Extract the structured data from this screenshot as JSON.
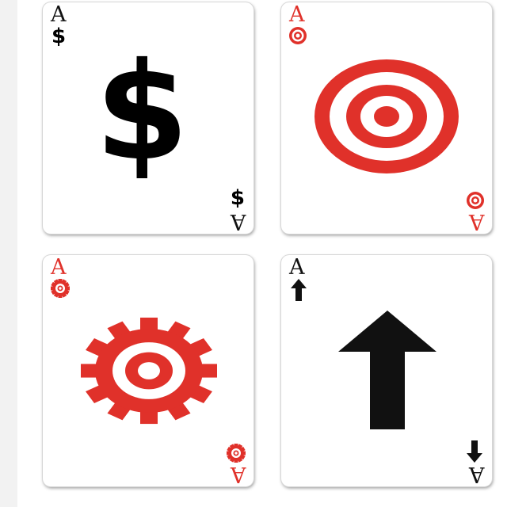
{
  "colors": {
    "black": "#111111",
    "red": "#e0312a"
  },
  "cards": [
    {
      "rank": "A",
      "suit": "dollar",
      "symbol": "$",
      "color": "black",
      "icon": "dollar-icon"
    },
    {
      "rank": "A",
      "suit": "target",
      "color": "red",
      "icon": "target-icon"
    },
    {
      "rank": "A",
      "suit": "gear",
      "color": "red",
      "icon": "gear-icon"
    },
    {
      "rank": "A",
      "suit": "arrow",
      "color": "black",
      "icon": "arrow-up-icon"
    }
  ]
}
